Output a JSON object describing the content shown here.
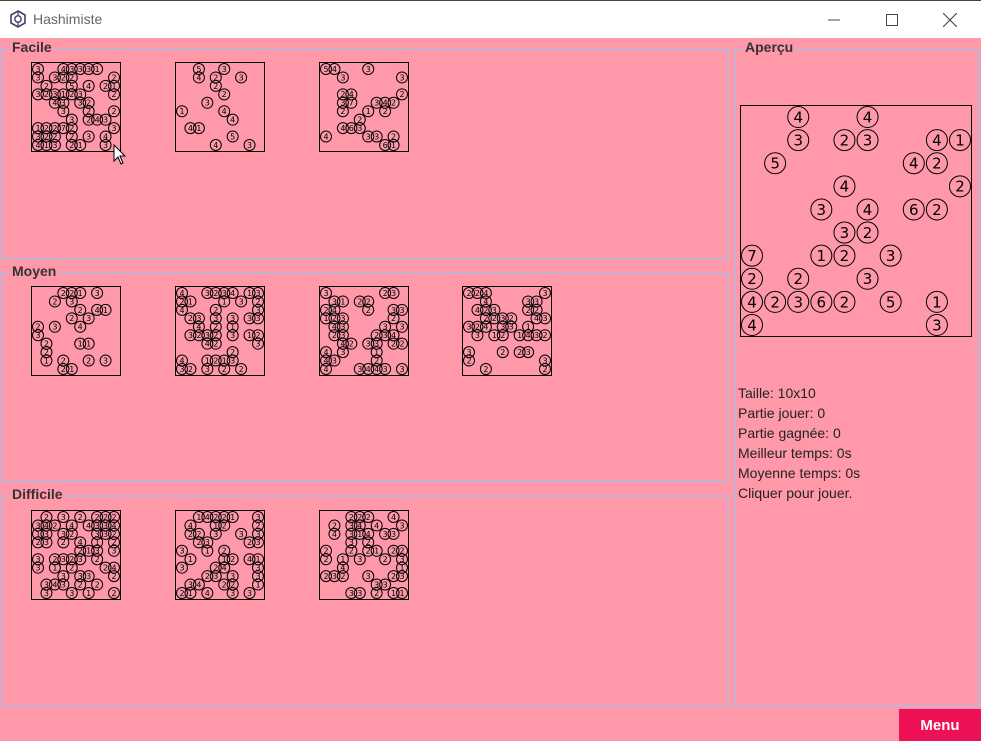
{
  "window": {
    "title": "Hashimiste",
    "controls": [
      "minimize-icon",
      "maximize-icon",
      "close-icon"
    ]
  },
  "sections": [
    {
      "label": "Facile",
      "levels": [
        {
          "clues": [
            "3",
            "3",
            "2",
            "3",
            "4",
            "1",
            "2",
            "5",
            "2",
            "1",
            "3",
            "2",
            "2",
            "3",
            "4",
            "3",
            "3",
            "2",
            "2",
            "1",
            "3",
            "7",
            "2",
            "3",
            "3",
            "2",
            "4",
            "1",
            "3",
            "2",
            "2",
            "3",
            "4",
            "2",
            "3",
            "1",
            "2",
            "3",
            "2",
            "1",
            "4",
            "2",
            "3",
            "4",
            "3",
            "3",
            "2",
            "3",
            "2",
            "2",
            "3",
            "2"
          ]
        },
        {
          "clues": [
            "4",
            "5",
            "4",
            "1",
            "4",
            "5",
            "4",
            "3",
            "1",
            "2",
            "2",
            "3",
            "3",
            "4",
            "3",
            "2"
          ]
        },
        {
          "clues": [
            "2",
            "3",
            "4",
            "2",
            "1",
            "3",
            "3",
            "2",
            "6",
            "4",
            "2",
            "3",
            "5",
            "6",
            "7",
            "3",
            "1",
            "2",
            "3",
            "4",
            "2",
            "4",
            "2",
            "3",
            "3",
            "4"
          ]
        }
      ]
    },
    {
      "label": "Moyen",
      "levels": [
        {
          "clues": [
            "1",
            "3",
            "2",
            "4",
            "1",
            "3",
            "2",
            "2",
            "1",
            "3",
            "3",
            "2",
            "1",
            "4",
            "1",
            "2",
            "3",
            "2",
            "2",
            "2",
            "3",
            "2",
            "2",
            "1",
            "2"
          ]
        },
        {
          "clues": [
            "2",
            "3",
            "1",
            "2",
            "3",
            "2",
            "3",
            "4",
            "3",
            "3",
            "2",
            "1",
            "3",
            "2",
            "4",
            "3",
            "1",
            "2",
            "3",
            "2",
            "4",
            "1",
            "3",
            "2",
            "4",
            "1",
            "2",
            "3",
            "3",
            "2",
            "4",
            "3",
            "2",
            "3",
            "3",
            "2",
            "2",
            "1",
            "3",
            "2",
            "3",
            "4",
            "1",
            "2",
            "3"
          ]
        },
        {
          "clues": [
            "2",
            "3",
            "3",
            "4",
            "3",
            "2",
            "1",
            "3",
            "2",
            "4",
            "3",
            "3",
            "2",
            "4",
            "2",
            "3",
            "3",
            "2",
            "1",
            "4",
            "3",
            "4",
            "2",
            "3",
            "4",
            "2",
            "3",
            "3",
            "2",
            "3",
            "2",
            "3",
            "4",
            "1",
            "2",
            "3",
            "2",
            "3",
            "4",
            "2",
            "3",
            "4",
            "3"
          ]
        },
        {
          "clues": [
            "3",
            "2",
            "2",
            "4",
            "3",
            "2",
            "2",
            "3",
            "4",
            "1",
            "2",
            "3",
            "3",
            "2",
            "4",
            "2",
            "3",
            "1",
            "2",
            "3",
            "4",
            "3",
            "2",
            "2",
            "4",
            "3",
            "2",
            "3",
            "1",
            "2",
            "4",
            "2",
            "3",
            "3",
            "2",
            "3",
            "2",
            "2",
            "3"
          ]
        }
      ]
    },
    {
      "label": "Difficile",
      "levels": [
        {
          "clues": [
            "3",
            "2",
            "3",
            "4",
            "3",
            "2",
            "3",
            "2",
            "2",
            "4",
            "3",
            "2",
            "3",
            "1",
            "2",
            "3",
            "2",
            "2",
            "3",
            "4",
            "3",
            "2",
            "1",
            "3",
            "2",
            "3",
            "4",
            "3",
            "2",
            "3",
            "2",
            "1",
            "4",
            "3",
            "2",
            "3",
            "4",
            "3",
            "2",
            "1",
            "3",
            "2",
            "3",
            "2",
            "4",
            "3",
            "2",
            "2",
            "3",
            "3",
            "2",
            "1",
            "3",
            "2",
            "2"
          ]
        },
        {
          "clues": [
            "2",
            "3",
            "1",
            "3",
            "2",
            "4",
            "1",
            "3",
            "2",
            "1",
            "2",
            "3",
            "4",
            "2",
            "3",
            "4",
            "1",
            "2",
            "3",
            "2",
            "1",
            "3",
            "4",
            "2",
            "3",
            "2",
            "4",
            "3",
            "1",
            "2",
            "3",
            "2",
            "3",
            "1",
            "3",
            "2",
            "1",
            "3",
            "2",
            "3",
            "1",
            "2",
            "4",
            "2",
            "3"
          ]
        },
        {
          "clues": [
            "2",
            "3",
            "1",
            "2",
            "3",
            "4",
            "2",
            "1",
            "3",
            "2",
            "3",
            "2",
            "4",
            "3",
            "1",
            "2",
            "3",
            "4",
            "2",
            "3",
            "3",
            "2",
            "1",
            "2",
            "4",
            "3",
            "2",
            "3",
            "1",
            "2",
            "3",
            "4",
            "2",
            "3",
            "2",
            "1",
            "3",
            "2",
            "4",
            "2",
            "3",
            "3",
            "2"
          ]
        }
      ]
    }
  ],
  "preview": {
    "label": "Aperçu",
    "clues": [
      "3",
      "2",
      "3",
      "3",
      "2",
      "5",
      "4",
      "3",
      "1",
      "1",
      "4",
      "4",
      "6",
      "4",
      "2",
      "2",
      "5",
      "7",
      "6",
      "4",
      "3",
      "1",
      "2",
      "4",
      "4",
      "2",
      "2",
      "2",
      "3",
      "3",
      "4",
      "3",
      "2",
      "2"
    ]
  },
  "stats": {
    "size": "Taille: 10x10",
    "played": "Partie jouer: 0",
    "won": "Partie gagnée: 0",
    "best_time": "Meilleur temps: 0s",
    "avg_time": "Moyenne temps: 0s",
    "hint": "Cliquer pour jouer."
  },
  "menu_label": "Menu",
  "colors": {
    "background": "#ff99aa",
    "group_border": "#c3b3d3",
    "menu_button": "#ee1155",
    "menu_text": "#ffffff"
  }
}
